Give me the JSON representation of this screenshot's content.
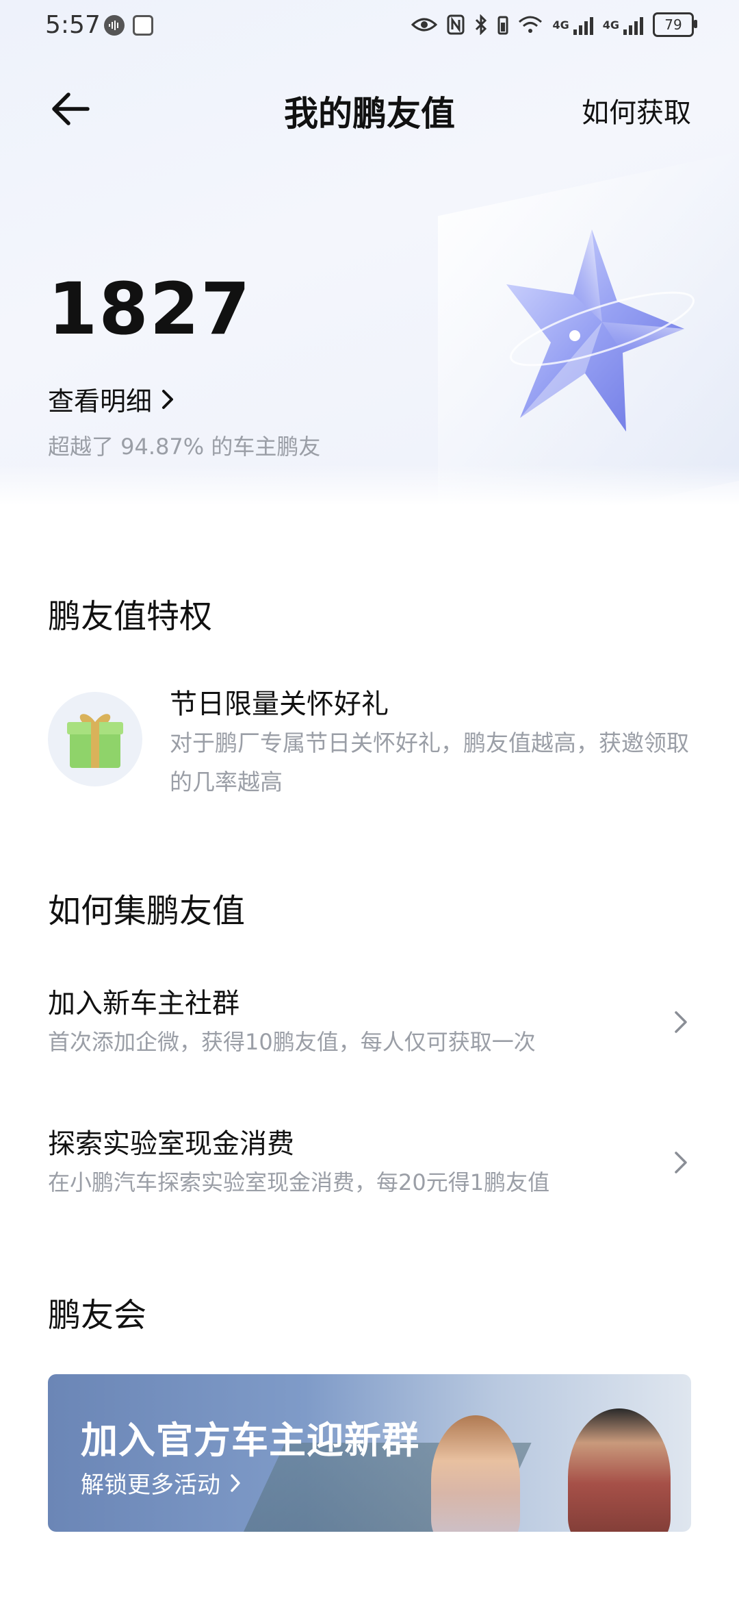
{
  "status_bar": {
    "time": "5:57",
    "network_1": "4G",
    "network_2": "4G",
    "battery": "79"
  },
  "nav": {
    "title": "我的鹏友值",
    "action": "如何获取"
  },
  "score": {
    "value": "1827",
    "detail_link": "查看明细",
    "rank_text": "超越了 94.87% 的车主鹏友"
  },
  "privileges": {
    "title": "鹏友值特权",
    "items": [
      {
        "title": "节日限量关怀好礼",
        "description": "对于鹏厂专属节日关怀好礼，鹏友值越高，获邀领取的几率越高",
        "icon": "gift-icon"
      }
    ]
  },
  "earn": {
    "title": "如何集鹏友值",
    "items": [
      {
        "title": "加入新车主社群",
        "description": "首次添加企微，获得10鹏友值，每人仅可获取一次"
      },
      {
        "title": "探索实验室现金消费",
        "description": "在小鹏汽车探索实验室现金消费，每20元得1鹏友值"
      }
    ]
  },
  "club": {
    "title": "鹏友会",
    "banner_title": "加入官方车主迎新群",
    "banner_subtitle": "解锁更多活动"
  },
  "colors": {
    "accent": "#6e7ff0",
    "muted_text": "#9a9ea6",
    "gift_green": "#8fd36a"
  }
}
